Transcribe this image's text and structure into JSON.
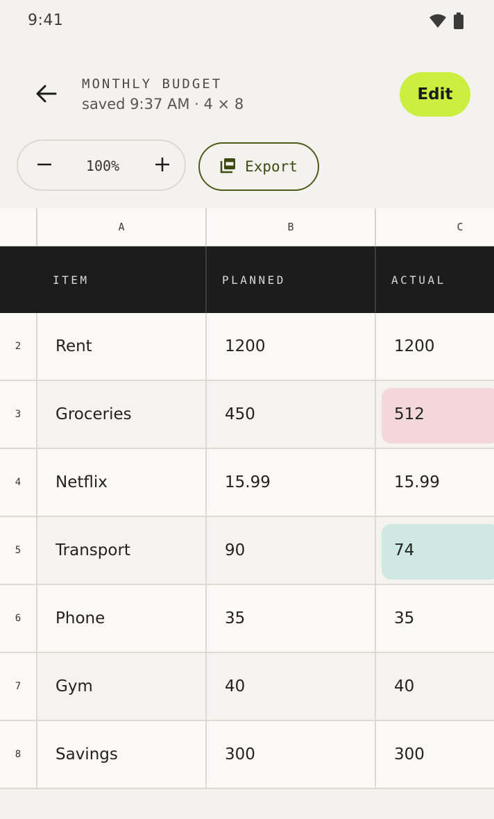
{
  "status": {
    "time": "9:41"
  },
  "header": {
    "title": "MONTHLY BUDGET",
    "subtitle": "saved 9:37 AM · 4 × 8",
    "edit_label": "Edit"
  },
  "toolbar": {
    "zoom_value": "100%",
    "export_label": "Export"
  },
  "sheet": {
    "columns": [
      "A",
      "B",
      "C"
    ],
    "header_row": [
      "ITEM",
      "PLANNED",
      "ACTUAL"
    ],
    "rows": [
      {
        "num": "2",
        "item": "Rent",
        "planned": "1200",
        "actual": "1200",
        "highlight": "none"
      },
      {
        "num": "3",
        "item": "Groceries",
        "planned": "450",
        "actual": "512",
        "highlight": "over"
      },
      {
        "num": "4",
        "item": "Netflix",
        "planned": "15.99",
        "actual": "15.99",
        "highlight": "none"
      },
      {
        "num": "5",
        "item": "Transport",
        "planned": "90",
        "actual": "74",
        "highlight": "under"
      },
      {
        "num": "6",
        "item": "Phone",
        "planned": "35",
        "actual": "35",
        "highlight": "none"
      },
      {
        "num": "7",
        "item": "Gym",
        "planned": "40",
        "actual": "40",
        "highlight": "none"
      },
      {
        "num": "8",
        "item": "Savings",
        "planned": "300",
        "actual": "300",
        "highlight": "none"
      }
    ]
  },
  "colors": {
    "accent": "#cbef3e",
    "export_border": "#4d5a19",
    "header_band": "#1c1c1c",
    "over_budget": "#f3d7d9",
    "under_budget": "#cfe9e2"
  }
}
